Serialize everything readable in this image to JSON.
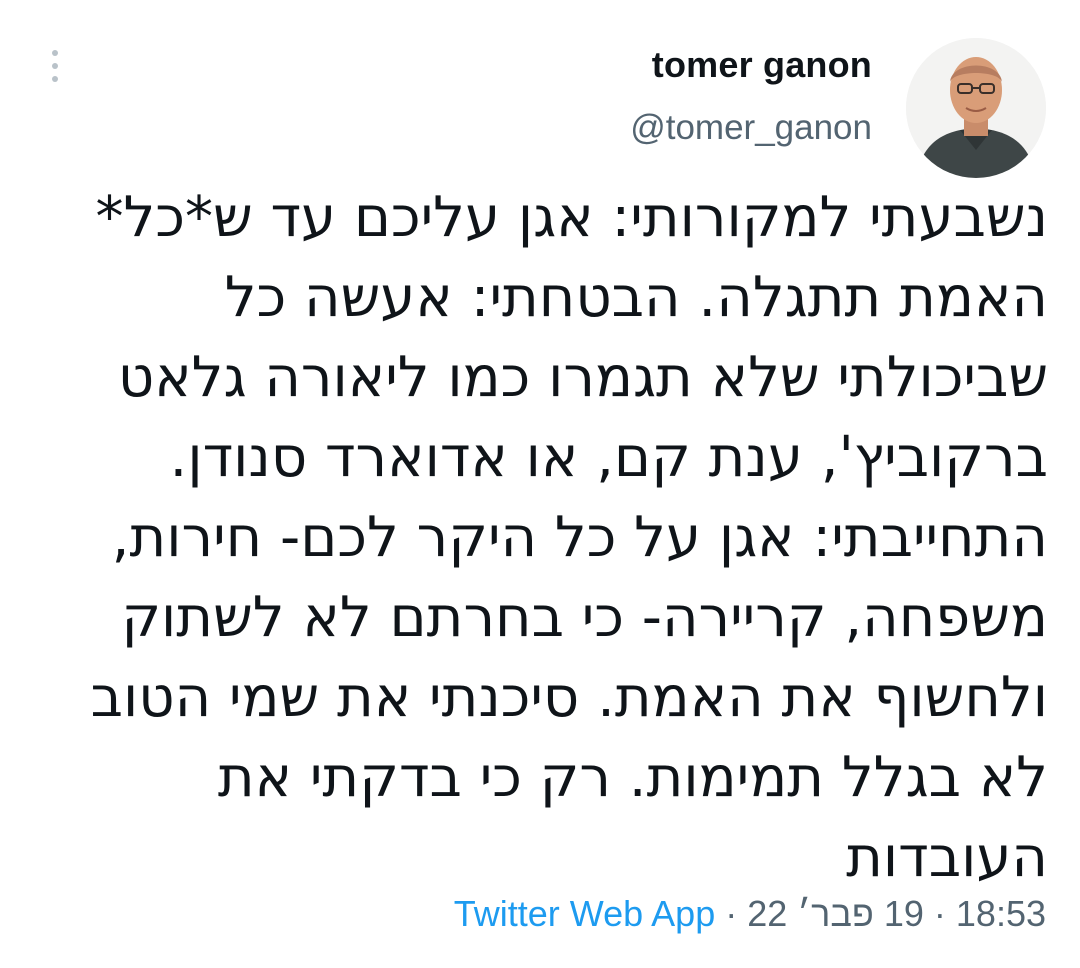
{
  "author": {
    "display_name": "tomer ganon",
    "handle": "@tomer_ganon"
  },
  "tweet": {
    "text": "נשבעתי למקורותי: אגן עליכם עד ש*כל*\nהאמת תתגלה. הבטחתי: אעשה כל\nשביכולתי שלא תגמרו כמו ליאורה גלאט\nברקוביץ', ענת קם, או אדוארד סנודן.\nהתחייבתי: אגן על כל היקר לכם- חירות,\nמשפחה, קריירה- כי בחרתם לא לשתוק\nולחשוף את האמת. סיכנתי את שמי הטוב\nלא בגלל תמימות. רק כי בדקתי את\nהעובדות"
  },
  "meta": {
    "time": "18:53",
    "date": "19 פבר׳ 22",
    "source": "Twitter Web App",
    "separator": "·"
  },
  "colors": {
    "text": "#0f1419",
    "secondary": "#536471",
    "link": "#1d9bf0"
  },
  "icons": {
    "more": "vertical-ellipsis-icon"
  }
}
